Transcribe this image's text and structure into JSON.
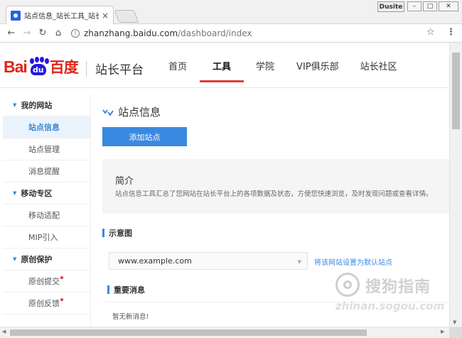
{
  "browser": {
    "tab_title": "站点信息_站长工具_站长",
    "tab_close": "×",
    "profile_name": "Dusite",
    "window_minimize": "–",
    "window_restore": "□",
    "window_close": "✕",
    "back_glyph": "←",
    "forward_glyph": "→",
    "reload_glyph": "↻",
    "home_glyph": "⌂",
    "info_glyph": "i",
    "url_host": "zhanzhang.baidu.com",
    "url_path": "/dashboard/index",
    "star_glyph": "☆",
    "menu_glyph": "⋮"
  },
  "logo": {
    "bai": "Bai",
    "du": "du",
    "cn": "百度"
  },
  "header": {
    "platform_name": "站长平台",
    "nav": [
      {
        "label": "首页",
        "active": false
      },
      {
        "label": "工具",
        "active": true
      },
      {
        "label": "学院",
        "active": false
      },
      {
        "label": "VIP俱乐部",
        "active": false
      },
      {
        "label": "站长社区",
        "active": false
      }
    ]
  },
  "sidebar": {
    "groups": [
      {
        "label": "我的网站",
        "items": [
          {
            "label": "站点信息",
            "active": true,
            "badge": false
          },
          {
            "label": "站点管理",
            "active": false,
            "badge": false
          },
          {
            "label": "消息提醒",
            "active": false,
            "badge": false
          }
        ]
      },
      {
        "label": "移动专区",
        "items": [
          {
            "label": "移动适配",
            "active": false,
            "badge": false
          },
          {
            "label": "MIP引入",
            "active": false,
            "badge": false
          }
        ]
      },
      {
        "label": "原创保护",
        "items": [
          {
            "label": "原创提交",
            "active": false,
            "badge": true
          },
          {
            "label": "原创反馈",
            "active": false,
            "badge": true
          }
        ]
      }
    ]
  },
  "main": {
    "page_title": "站点信息",
    "add_site_label": "添加站点",
    "intro_title": "简介",
    "intro_text": "站点信息工具汇总了您网站在站长平台上的各项数据及状态，方便您快速浏览，及时发现问题或查看详情。",
    "schematic_heading": "示意图",
    "site_select_value": "www.example.com",
    "set_default_link": "将该网站设置为默认站点",
    "important_heading": "重要消息",
    "no_messages": "暂无新消息!"
  },
  "watermark": {
    "cn": "搜狗指南",
    "en": "zhinan.sogou.com"
  },
  "colors": {
    "accent_blue": "#3a89e0",
    "active_underline": "#e4393c",
    "baidu_red": "#e1251b",
    "baidu_blue": "#2319dc"
  }
}
